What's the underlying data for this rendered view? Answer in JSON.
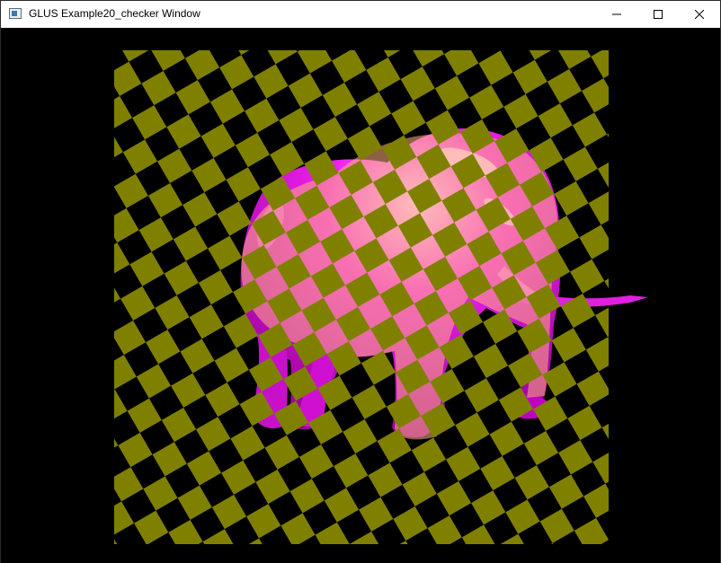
{
  "window": {
    "title": "GLUS Example20_checker Window",
    "icons": {
      "app": "app-window-icon",
      "minimize": "minimize-icon",
      "maximize": "maximize-icon",
      "close": "close-icon"
    }
  },
  "scene": {
    "background_color": "#000000",
    "checker_color": "#808000",
    "elephant_color": "#e019e0",
    "elephant_highlight": "#ffd0ff",
    "overlay_color": "#ffb080"
  }
}
